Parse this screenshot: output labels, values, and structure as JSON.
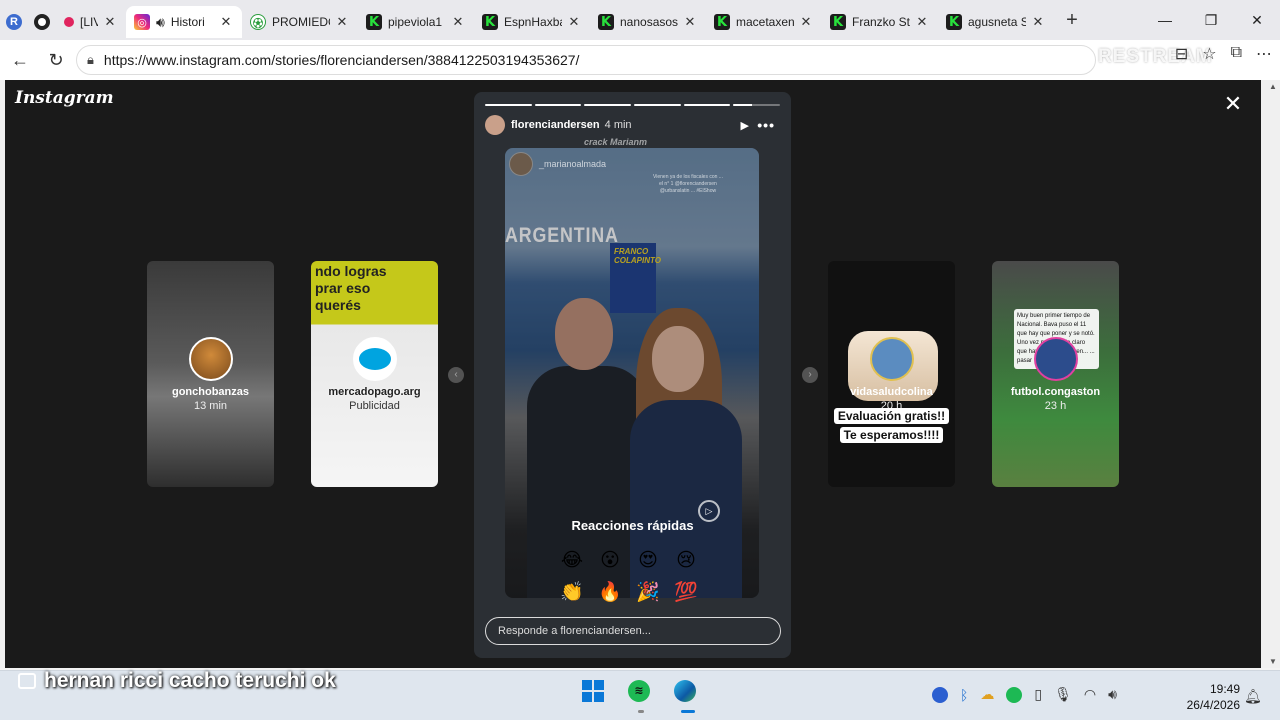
{
  "browser": {
    "tabs": [
      {
        "label": "",
        "favicon": "R",
        "fav_style": "r"
      },
      {
        "label": "",
        "favicon": "record",
        "fav_style": "rec"
      },
      {
        "label": "[LIV",
        "favicon": "red-dot",
        "fav_style": "reddot"
      },
      {
        "label": "Histori",
        "favicon": "instagram-icon",
        "fav_style": "ig",
        "audio": "speaker-icon",
        "active": true
      },
      {
        "label": "PROMIEDO",
        "favicon": "soccer-ball-icon",
        "fav_style": "ball"
      },
      {
        "label": "pipeviola1",
        "favicon": "K",
        "fav_style": "k"
      },
      {
        "label": "EspnHaxba",
        "favicon": "K",
        "fav_style": "k"
      },
      {
        "label": "nanosasos",
        "favicon": "K",
        "fav_style": "k"
      },
      {
        "label": "macetaxen",
        "favicon": "K",
        "fav_style": "k"
      },
      {
        "label": "Franzko Str",
        "favicon": "K",
        "fav_style": "k"
      },
      {
        "label": "agusneta S",
        "favicon": "K",
        "fav_style": "k"
      }
    ],
    "new_tab": "+",
    "window_controls": {
      "minimize": "—",
      "restore": "❐",
      "close": "✕"
    },
    "url": "https://www.instagram.com/stories/florenciandersen/3884122503194353627/",
    "watermark": "RESTREAM"
  },
  "instagram": {
    "logo": "Instagram",
    "close": "✕",
    "previews": [
      {
        "user": "gonchobanzas",
        "time": "13 min"
      },
      {
        "user": "mercadopago.arg",
        "time": "Publicidad",
        "ad_text": "ndo lograsprar esoquerés"
      },
      {
        "user": "vidasaludcolina",
        "time": "20 h",
        "promo_line1": "Evaluación gratis!!",
        "promo_line2": "Te esperamos!!!!"
      },
      {
        "user": "futbol.congaston",
        "time": "23 h",
        "caption": "Muy buen primer tiempo de Nacional. Bava puso el 11 que hay que poner y se notó. Uno vez más queda claro que hay que andar inven... ... pasar"
      }
    ],
    "story": {
      "username": "florenciandersen",
      "time": "4 min",
      "progress": [
        1,
        1,
        1,
        1,
        1,
        0.4
      ],
      "overlay_text": "crack Marianm",
      "reposter": "_marianoalmada",
      "mention": "Vienen ya de los fiscales con ... el n° 1 @florenciandersen @urbanslatin ... #ElShow",
      "sign_text": "ARGENTINA",
      "franco_text": "FRANCO COLAPINTO",
      "reactions_title": "Reacciones rápidas",
      "emojis": [
        "😂",
        "😮",
        "😍",
        "😢",
        "👏",
        "🔥",
        "🎉",
        "💯"
      ],
      "reply_placeholder": "Responde a florenciandersen..."
    }
  },
  "taskbar": {
    "caption": "hernan ricci cacho teruchi ok",
    "time": "19:49",
    "date": "26/4/2026"
  },
  "colors": {
    "ig_background": "#1a1a1a",
    "kick_green": "#28e23c",
    "spotify_green": "#1db954",
    "windows_blue": "#0a78d7"
  }
}
